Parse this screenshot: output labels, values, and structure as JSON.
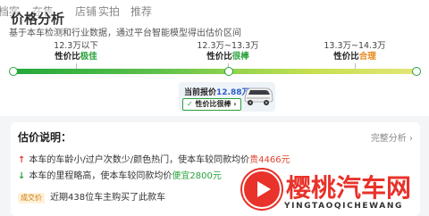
{
  "nav": {
    "tabs": [
      "档案",
      "在售",
      "店铺",
      "实拍",
      "推荐"
    ]
  },
  "header": {
    "title": "价格分析",
    "subtitle": "基于本车检测和行业数据，通过平台智能模型得出估价区间"
  },
  "ranges": [
    {
      "price": "12.3万以下",
      "label_prefix": "性价比",
      "label_em": "极佳"
    },
    {
      "price": "12.3万~13.3万",
      "label_prefix": "性价比",
      "label_em": "很棒"
    },
    {
      "price": "13.3万~14.3万",
      "label_prefix": "性价比",
      "label_em": "合理"
    }
  ],
  "offer": {
    "price_label": "当前报价",
    "price_value": "12.88万",
    "badge_check": "✓",
    "badge_text": "性价比很棒",
    "badge_chevron": "›"
  },
  "analysis": {
    "title": "估价说明：",
    "link": "完整分析 ›",
    "rows": [
      {
        "arrow": "↑",
        "text": "本车的车龄小/过户次数少/颜色热门，使本车较同款均价",
        "em": "贵4466元"
      },
      {
        "arrow": "↓",
        "text": "本车的里程略高，使本车较同款均价",
        "em": "便宜2800元"
      }
    ],
    "deal": {
      "badge": "成交价",
      "text": "近期438位车主购买了此款车"
    }
  },
  "watermark": {
    "cn": "樱桃汽车网",
    "en": "YINGTAOQICHEWANG"
  },
  "colors": {
    "green": "#2aa23d",
    "orange": "#e8891f",
    "red": "#e0442f",
    "blue": "#2d5fc8",
    "logo_red": "#e8322a"
  }
}
